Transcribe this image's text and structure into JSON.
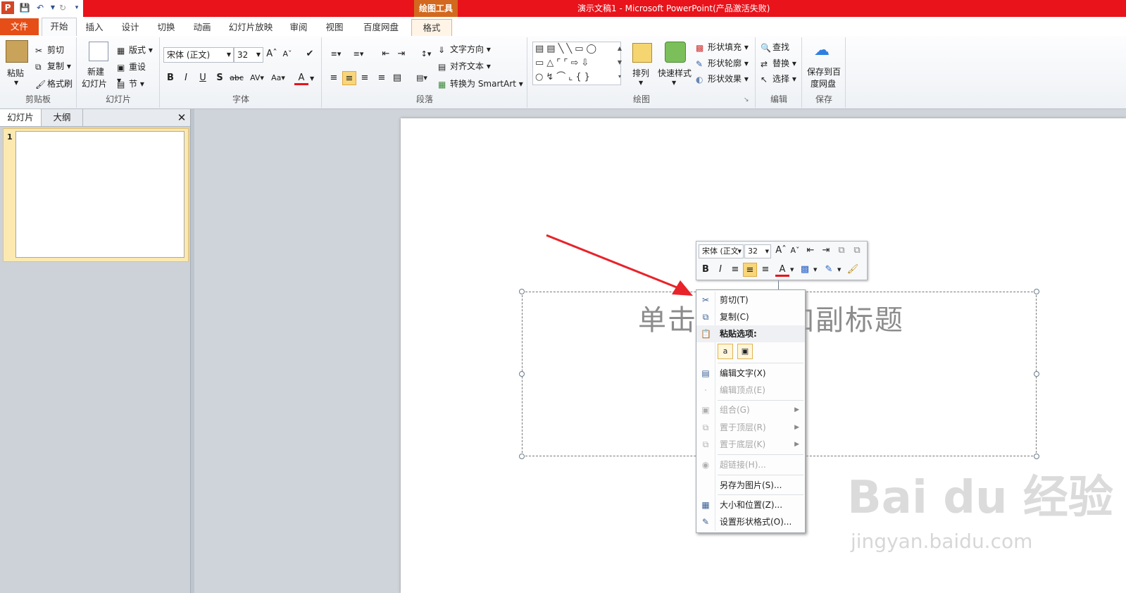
{
  "titlebar": {
    "context_tab": "绘图工具",
    "window_title": "演示文稿1 - Microsoft PowerPoint(产品激活失败)"
  },
  "tabs": [
    "文件",
    "开始",
    "插入",
    "设计",
    "切换",
    "动画",
    "幻灯片放映",
    "审阅",
    "视图",
    "百度网盘",
    "格式"
  ],
  "ribbon": {
    "clipboard": {
      "paste": "粘贴",
      "cut": "剪切",
      "copy": "复制",
      "format_painter": "格式刷",
      "label": "剪贴板"
    },
    "slides": {
      "new_slide_1": "新建",
      "new_slide_2": "幻灯片",
      "layout": "版式",
      "reset": "重设",
      "section": "节",
      "label": "幻灯片"
    },
    "font": {
      "font_name": "宋体 (正文)",
      "font_size": "32",
      "label": "字体"
    },
    "paragraph": {
      "text_direction": "文字方向",
      "align_text": "对齐文本",
      "smartart": "转换为 SmartArt",
      "label": "段落"
    },
    "drawing": {
      "arrange": "排列",
      "quick_styles": "快速样式",
      "fill": "形状填充",
      "outline": "形状轮廓",
      "effects": "形状效果",
      "label": "绘图"
    },
    "editing": {
      "find": "查找",
      "replace": "替换",
      "select": "选择",
      "label": "编辑"
    },
    "save": {
      "save_baidu_1": "保存到百",
      "save_baidu_2": "度网盘",
      "label": "保存"
    }
  },
  "left_panel": {
    "tab_slides": "幻灯片",
    "tab_outline": "大纲",
    "slide_number": "1"
  },
  "slide": {
    "subtitle_placeholder": "单击此处添加副标题"
  },
  "mini_toolbar": {
    "font_name": "宋体 (正文",
    "font_size": "32"
  },
  "context_menu": {
    "cut": "剪切(T)",
    "copy": "复制(C)",
    "paste_options": "粘贴选项:",
    "edit_text": "编辑文字(X)",
    "edit_points": "编辑顶点(E)",
    "group": "组合(G)",
    "bring_front": "置于顶层(R)",
    "send_back": "置于底层(K)",
    "hyperlink": "超链接(H)...",
    "save_as_picture": "另存为图片(S)...",
    "size_position": "大小和位置(Z)...",
    "format_shape": "设置形状格式(O)..."
  },
  "watermark": {
    "brand": "Bai du 经验",
    "url": "jingyan.baidu.com"
  },
  "colors": {
    "title_red": "#e8131b",
    "file_tab": "#e54e16",
    "context_orange": "#d2691e",
    "arrow_red": "#e8232a"
  }
}
